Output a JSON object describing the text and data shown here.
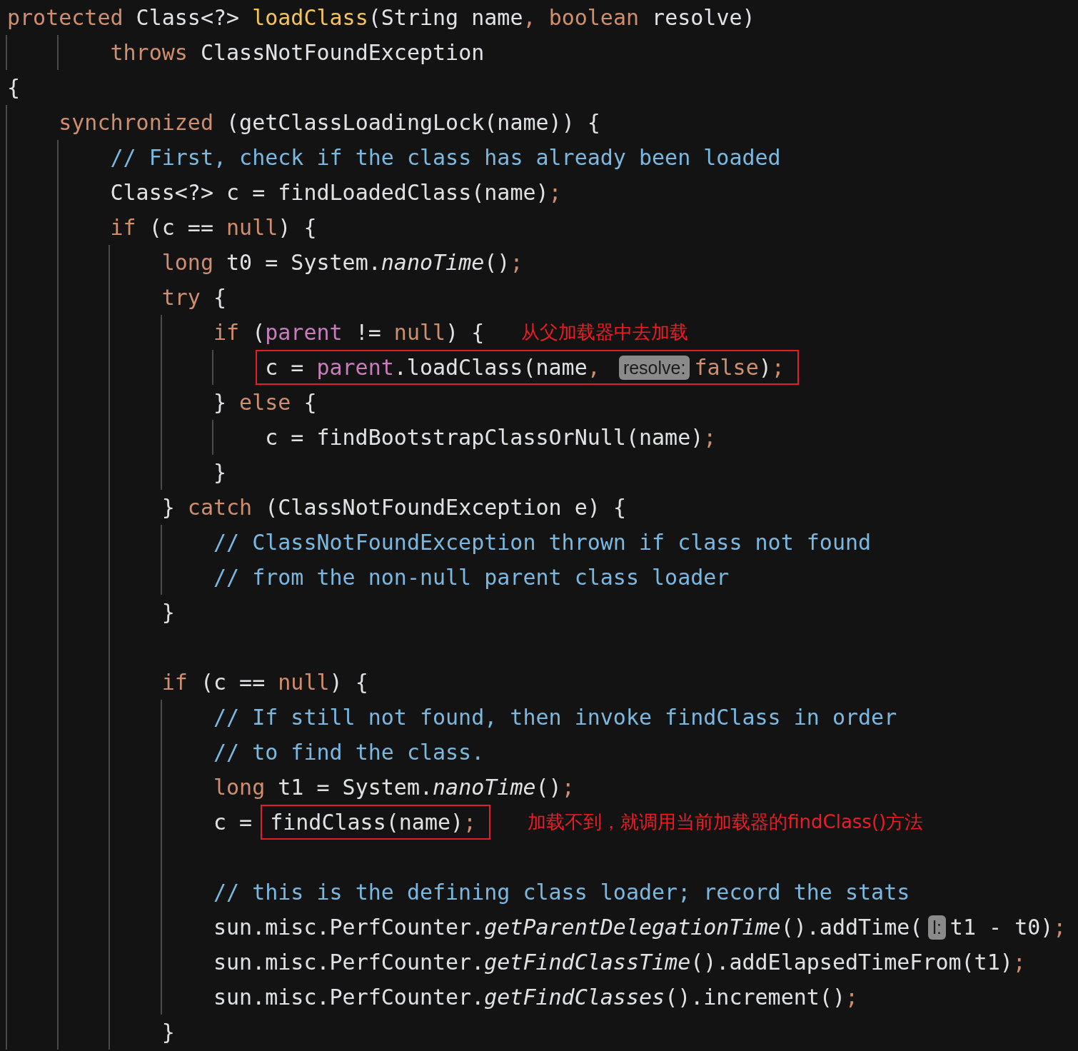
{
  "editor": {
    "lines": [
      {
        "kind": "code",
        "parts": [
          {
            "kind": "code",
            "tokens": [
              {
                "kind": "kw",
                "text": "protected"
              },
              {
                "kind": "txt",
                "text": " Class<?> "
              },
              {
                "kind": "decl",
                "text": "loadClass"
              },
              {
                "kind": "txt",
                "text": "(String name"
              },
              {
                "kind": "pun",
                "text": ", "
              },
              {
                "kind": "kw",
                "text": "boolean"
              },
              {
                "kind": "txt",
                "text": " resolve)"
              }
            ]
          }
        ]
      },
      {
        "kind": "code",
        "parts": [
          {
            "kind": "code",
            "tokens": [
              {
                "kind": "kw",
                "text": "        throws"
              },
              {
                "kind": "txt",
                "text": " ClassNotFoundException"
              }
            ]
          }
        ]
      },
      {
        "kind": "code",
        "parts": [
          {
            "kind": "code",
            "tokens": [
              {
                "kind": "txt",
                "text": "{"
              }
            ]
          }
        ]
      },
      {
        "kind": "code",
        "parts": [
          {
            "kind": "code",
            "tokens": [
              {
                "kind": "kw",
                "text": "    synchronized"
              },
              {
                "kind": "txt",
                "text": " (getClassLoadingLock(name)) {"
              }
            ]
          }
        ]
      },
      {
        "kind": "code",
        "parts": [
          {
            "kind": "code",
            "tokens": [
              {
                "kind": "cmt",
                "text": "        // First, check if the class has already been loaded"
              }
            ]
          }
        ]
      },
      {
        "kind": "code",
        "parts": [
          {
            "kind": "code",
            "tokens": [
              {
                "kind": "txt",
                "text": "        Class<?> c = findLoadedClass(name)"
              },
              {
                "kind": "pun",
                "text": ";"
              }
            ]
          }
        ]
      },
      {
        "kind": "code",
        "parts": [
          {
            "kind": "code",
            "tokens": [
              {
                "kind": "kw",
                "text": "        if"
              },
              {
                "kind": "txt",
                "text": " (c == "
              },
              {
                "kind": "kw",
                "text": "null"
              },
              {
                "kind": "txt",
                "text": ") {"
              }
            ]
          }
        ]
      },
      {
        "kind": "code",
        "parts": [
          {
            "kind": "code",
            "tokens": [
              {
                "kind": "kw",
                "text": "            long"
              },
              {
                "kind": "txt",
                "text": " t0 = System."
              },
              {
                "kind": "ital",
                "text": "nanoTime"
              },
              {
                "kind": "txt",
                "text": "()"
              },
              {
                "kind": "pun",
                "text": ";"
              }
            ]
          }
        ]
      },
      {
        "kind": "code",
        "parts": [
          {
            "kind": "code",
            "tokens": [
              {
                "kind": "kw",
                "text": "            try"
              },
              {
                "kind": "txt",
                "text": " {"
              }
            ]
          }
        ]
      },
      {
        "kind": "code",
        "parts": [
          {
            "kind": "code",
            "tokens": [
              {
                "kind": "kw",
                "text": "                if"
              },
              {
                "kind": "txt",
                "text": " ("
              },
              {
                "kind": "fld",
                "text": "parent"
              },
              {
                "kind": "txt",
                "text": " != "
              },
              {
                "kind": "kw",
                "text": "null"
              },
              {
                "kind": "txt",
                "text": ") {"
              }
            ]
          },
          {
            "kind": "note",
            "text": "从父加载器中去加载"
          }
        ]
      },
      {
        "kind": "code",
        "parts": [
          {
            "kind": "box",
            "tokens": [
              {
                "kind": "txt",
                "text": "                    c = "
              },
              {
                "kind": "fld",
                "text": "parent"
              },
              {
                "kind": "txt",
                "text": ".loadClass(name"
              },
              {
                "kind": "pun",
                "text": ", "
              },
              {
                "kind": "hint",
                "text": "resolve:"
              },
              {
                "kind": "kw",
                "text": "false"
              },
              {
                "kind": "txt",
                "text": ")"
              },
              {
                "kind": "pun",
                "text": ";"
              }
            ]
          }
        ]
      },
      {
        "kind": "code",
        "parts": [
          {
            "kind": "code",
            "tokens": [
              {
                "kind": "txt",
                "text": "                } "
              },
              {
                "kind": "kw",
                "text": "else"
              },
              {
                "kind": "txt",
                "text": " {"
              }
            ]
          }
        ]
      },
      {
        "kind": "code",
        "parts": [
          {
            "kind": "code",
            "tokens": [
              {
                "kind": "txt",
                "text": "                    c = findBootstrapClassOrNull(name)"
              },
              {
                "kind": "pun",
                "text": ";"
              }
            ]
          }
        ]
      },
      {
        "kind": "code",
        "parts": [
          {
            "kind": "code",
            "tokens": [
              {
                "kind": "txt",
                "text": "                }"
              }
            ]
          }
        ]
      },
      {
        "kind": "code",
        "parts": [
          {
            "kind": "code",
            "tokens": [
              {
                "kind": "txt",
                "text": "            } "
              },
              {
                "kind": "kw",
                "text": "catch"
              },
              {
                "kind": "txt",
                "text": " (ClassNotFoundException e) {"
              }
            ]
          }
        ]
      },
      {
        "kind": "code",
        "parts": [
          {
            "kind": "code",
            "tokens": [
              {
                "kind": "cmt",
                "text": "                // ClassNotFoundException thrown if class not found"
              }
            ]
          }
        ]
      },
      {
        "kind": "code",
        "parts": [
          {
            "kind": "code",
            "tokens": [
              {
                "kind": "cmt",
                "text": "                // from the non-null parent class loader"
              }
            ]
          }
        ]
      },
      {
        "kind": "code",
        "parts": [
          {
            "kind": "code",
            "tokens": [
              {
                "kind": "txt",
                "text": "            }"
              }
            ]
          }
        ]
      },
      {
        "kind": "blank"
      },
      {
        "kind": "code",
        "parts": [
          {
            "kind": "code",
            "tokens": [
              {
                "kind": "kw",
                "text": "            if"
              },
              {
                "kind": "txt",
                "text": " (c == "
              },
              {
                "kind": "kw",
                "text": "null"
              },
              {
                "kind": "txt",
                "text": ") {"
              }
            ]
          }
        ]
      },
      {
        "kind": "code",
        "parts": [
          {
            "kind": "code",
            "tokens": [
              {
                "kind": "cmt",
                "text": "                // If still not found, then invoke findClass in order"
              }
            ]
          }
        ]
      },
      {
        "kind": "code",
        "parts": [
          {
            "kind": "code",
            "tokens": [
              {
                "kind": "cmt",
                "text": "                // to find the class."
              }
            ]
          }
        ]
      },
      {
        "kind": "code",
        "parts": [
          {
            "kind": "code",
            "tokens": [
              {
                "kind": "kw",
                "text": "                long"
              },
              {
                "kind": "txt",
                "text": " t1 = System."
              },
              {
                "kind": "ital",
                "text": "nanoTime"
              },
              {
                "kind": "txt",
                "text": "()"
              },
              {
                "kind": "pun",
                "text": ";"
              }
            ]
          }
        ]
      },
      {
        "kind": "code",
        "parts": [
          {
            "kind": "code",
            "tokens": [
              {
                "kind": "txt",
                "text": "                c ="
              }
            ]
          },
          {
            "kind": "box",
            "tokens": [
              {
                "kind": "txt",
                "text": "findClass(name)"
              },
              {
                "kind": "pun",
                "text": ";"
              }
            ]
          },
          {
            "kind": "note",
            "text": "加载不到，就调用当前加载器的findClass()方法"
          }
        ]
      },
      {
        "kind": "blank"
      },
      {
        "kind": "code",
        "parts": [
          {
            "kind": "code",
            "tokens": [
              {
                "kind": "cmt",
                "text": "                // this is the defining class loader; record the stats"
              }
            ]
          }
        ]
      },
      {
        "kind": "code",
        "parts": [
          {
            "kind": "code",
            "tokens": [
              {
                "kind": "txt",
                "text": "                sun.misc.PerfCounter."
              },
              {
                "kind": "ital",
                "text": "getParentDelegationTime"
              },
              {
                "kind": "txt",
                "text": "().addTime("
              },
              {
                "kind": "hint",
                "text": "l:"
              },
              {
                "kind": "txt",
                "text": "t1 - t0)"
              },
              {
                "kind": "pun",
                "text": ";"
              }
            ]
          }
        ]
      },
      {
        "kind": "code",
        "parts": [
          {
            "kind": "code",
            "tokens": [
              {
                "kind": "txt",
                "text": "                sun.misc.PerfCounter."
              },
              {
                "kind": "ital",
                "text": "getFindClassTime"
              },
              {
                "kind": "txt",
                "text": "().addElapsedTimeFrom(t1)"
              },
              {
                "kind": "pun",
                "text": ";"
              }
            ]
          }
        ]
      },
      {
        "kind": "code",
        "parts": [
          {
            "kind": "code",
            "tokens": [
              {
                "kind": "txt",
                "text": "                sun.misc.PerfCounter."
              },
              {
                "kind": "ital",
                "text": "getFindClasses"
              },
              {
                "kind": "txt",
                "text": "().increment()"
              },
              {
                "kind": "pun",
                "text": ";"
              }
            ]
          }
        ]
      },
      {
        "kind": "code",
        "parts": [
          {
            "kind": "code",
            "tokens": [
              {
                "kind": "txt",
                "text": "            }"
              }
            ]
          }
        ]
      }
    ]
  }
}
